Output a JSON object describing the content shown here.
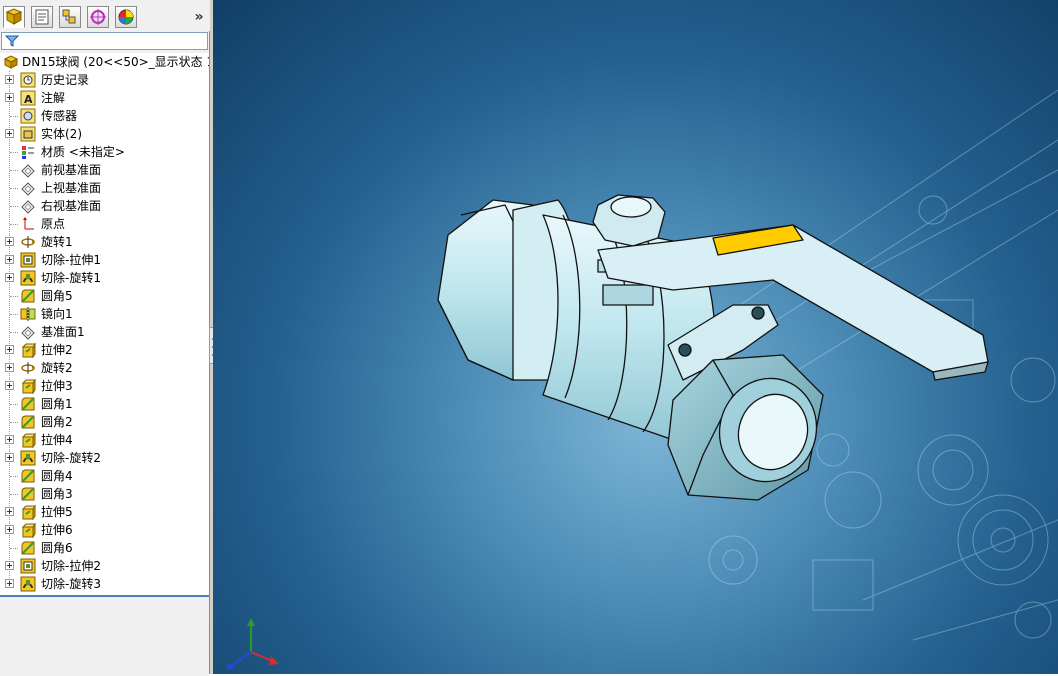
{
  "panel": {
    "tabs": [
      {
        "icon": "feature-manager-icon",
        "selected": true
      },
      {
        "icon": "property-manager-icon",
        "selected": false
      },
      {
        "icon": "configuration-manager-icon",
        "selected": false
      },
      {
        "icon": "dimxpert-manager-icon",
        "selected": false
      },
      {
        "icon": "display-manager-icon",
        "selected": false
      }
    ],
    "more_label": "»",
    "filter_icon": "filter-icon"
  },
  "tree": {
    "root": {
      "label": "DN15球阀  (20<<50>_显示状态 1",
      "icon": "part-icon"
    },
    "items": [
      {
        "label": "历史记录",
        "icon": "history-icon",
        "expandable": true
      },
      {
        "label": "注解",
        "icon": "annotation-icon",
        "expandable": true
      },
      {
        "label": "传感器",
        "icon": "sensor-icon",
        "expandable": false
      },
      {
        "label": "实体(2)",
        "icon": "solid-bodies-icon",
        "expandable": true
      },
      {
        "label": "材质 <未指定>",
        "icon": "material-icon",
        "expandable": false
      },
      {
        "label": "前视基准面",
        "icon": "plane-icon",
        "expandable": false
      },
      {
        "label": "上视基准面",
        "icon": "plane-icon",
        "expandable": false
      },
      {
        "label": "右视基准面",
        "icon": "plane-icon",
        "expandable": false
      },
      {
        "label": "原点",
        "icon": "origin-icon",
        "expandable": false
      },
      {
        "label": "旋转1",
        "icon": "revolve-icon",
        "expandable": true
      },
      {
        "label": "切除-拉伸1",
        "icon": "cut-extrude-icon",
        "expandable": true
      },
      {
        "label": "切除-旋转1",
        "icon": "cut-revolve-icon",
        "expandable": true
      },
      {
        "label": "圆角5",
        "icon": "fillet-icon",
        "expandable": false
      },
      {
        "label": "镜向1",
        "icon": "mirror-icon",
        "expandable": false
      },
      {
        "label": "基准面1",
        "icon": "plane-icon",
        "expandable": false
      },
      {
        "label": "拉伸2",
        "icon": "extrude-icon",
        "expandable": true
      },
      {
        "label": "旋转2",
        "icon": "revolve-icon",
        "expandable": true
      },
      {
        "label": "拉伸3",
        "icon": "extrude-icon",
        "expandable": true
      },
      {
        "label": "圆角1",
        "icon": "fillet-icon",
        "expandable": false
      },
      {
        "label": "圆角2",
        "icon": "fillet-icon",
        "expandable": false
      },
      {
        "label": "拉伸4",
        "icon": "extrude-icon",
        "expandable": true
      },
      {
        "label": "切除-旋转2",
        "icon": "cut-revolve-icon",
        "expandable": true
      },
      {
        "label": "圆角4",
        "icon": "fillet-icon",
        "expandable": false
      },
      {
        "label": "圆角3",
        "icon": "fillet-icon",
        "expandable": false
      },
      {
        "label": "拉伸5",
        "icon": "extrude-icon",
        "expandable": true
      },
      {
        "label": "拉伸6",
        "icon": "extrude-icon",
        "expandable": true
      },
      {
        "label": "圆角6",
        "icon": "fillet-icon",
        "expandable": false
      },
      {
        "label": "切除-拉伸2",
        "icon": "cut-extrude-icon",
        "expandable": true
      },
      {
        "label": "切除-旋转3",
        "icon": "cut-revolve-icon",
        "expandable": true
      }
    ]
  },
  "viewport": {
    "model": "ball-valve-model",
    "handle_accent_color": "#ffcc00",
    "background_color": "#245f8e",
    "triad": "coordinate-triad-icon"
  }
}
